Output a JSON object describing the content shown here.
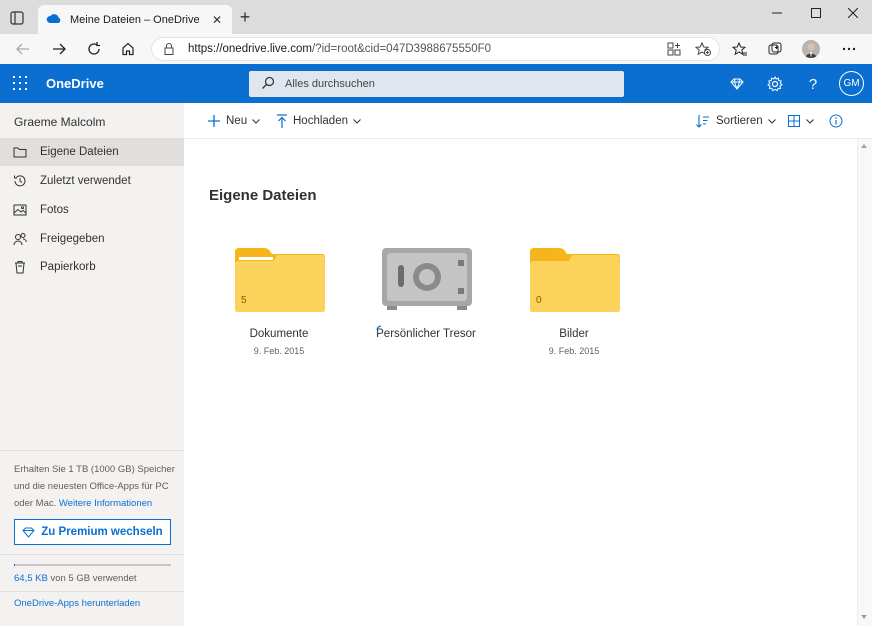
{
  "browser": {
    "tab_title": "Meine Dateien – OneDrive",
    "url_domain": "https://onedrive.live.com",
    "url_rest": "/?id=root&cid=047D3988675550F0"
  },
  "header": {
    "brand": "OneDrive",
    "search_placeholder": "Alles durchsuchen",
    "avatar_initials": "GM"
  },
  "sidebar": {
    "user_name": "Graeme Malcolm",
    "items": [
      {
        "label": "Eigene Dateien",
        "icon": "folder-icon",
        "active": true
      },
      {
        "label": "Zuletzt verwendet",
        "icon": "history-icon"
      },
      {
        "label": "Fotos",
        "icon": "photo-icon"
      },
      {
        "label": "Freigegeben",
        "icon": "people-icon"
      },
      {
        "label": "Papierkorb",
        "icon": "trash-icon"
      }
    ],
    "promo_text": "Erhalten Sie 1 TB (1000 GB) Speicher und die neuesten Office-Apps für PC oder Mac.",
    "promo_link": "Weitere Informationen",
    "premium_button": "Zu Premium wechseln",
    "storage_used": "64,5 KB",
    "storage_rest": "von 5 GB verwendet",
    "storage_fraction": 1.29e-05,
    "apps_link": "OneDrive-Apps herunterladen"
  },
  "toolbar": {
    "new_label": "Neu",
    "upload_label": "Hochladen",
    "sort_label": "Sortieren"
  },
  "main": {
    "title": "Eigene Dateien",
    "items": [
      {
        "name": "Dokumente",
        "date": "9. Feb. 2015",
        "count": "5",
        "type": "folder"
      },
      {
        "name": "Persönlicher Tresor",
        "date": "",
        "type": "vault"
      },
      {
        "name": "Bilder",
        "date": "9. Feb. 2015",
        "count": "0",
        "type": "folder"
      }
    ]
  },
  "colors": {
    "accent": "#0a6fd1",
    "folder": "#fcd35a"
  }
}
